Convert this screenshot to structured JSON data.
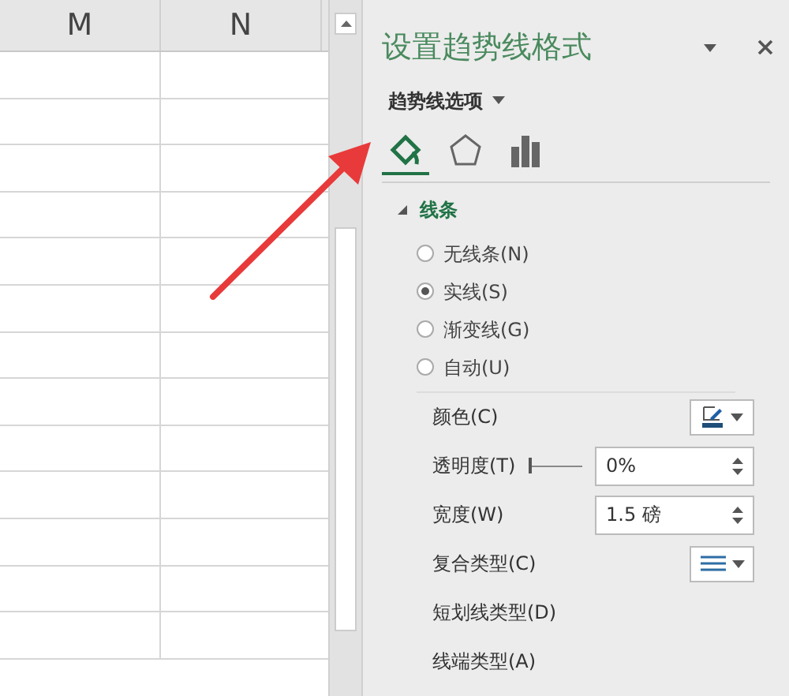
{
  "sheet": {
    "columns": [
      "M",
      "N"
    ]
  },
  "panel": {
    "title": "设置趋势线格式",
    "subtitle": "趋势线选项",
    "tabs": [
      {
        "kind": "fill",
        "selected": true
      },
      {
        "kind": "effects",
        "selected": false
      },
      {
        "kind": "options",
        "selected": false
      }
    ],
    "section": {
      "label": "线条",
      "expanded": true
    },
    "radios": [
      {
        "label": "无线条(N)",
        "selected": false
      },
      {
        "label": "实线(S)",
        "selected": true
      },
      {
        "label": "渐变线(G)",
        "selected": false
      },
      {
        "label": "自动(U)",
        "selected": false
      }
    ],
    "properties": [
      {
        "kind": "color",
        "label": "颜色(C)"
      },
      {
        "kind": "slider-spinner",
        "label": "透明度(T)",
        "value": "0%",
        "level": 0
      },
      {
        "kind": "spinner",
        "label": "宽度(W)",
        "value": "1.5 磅"
      },
      {
        "kind": "compound",
        "label": "复合类型(C)"
      },
      {
        "kind": "plain",
        "label": "短划线类型(D)"
      },
      {
        "kind": "plain",
        "label": "线端类型(A)"
      }
    ]
  }
}
